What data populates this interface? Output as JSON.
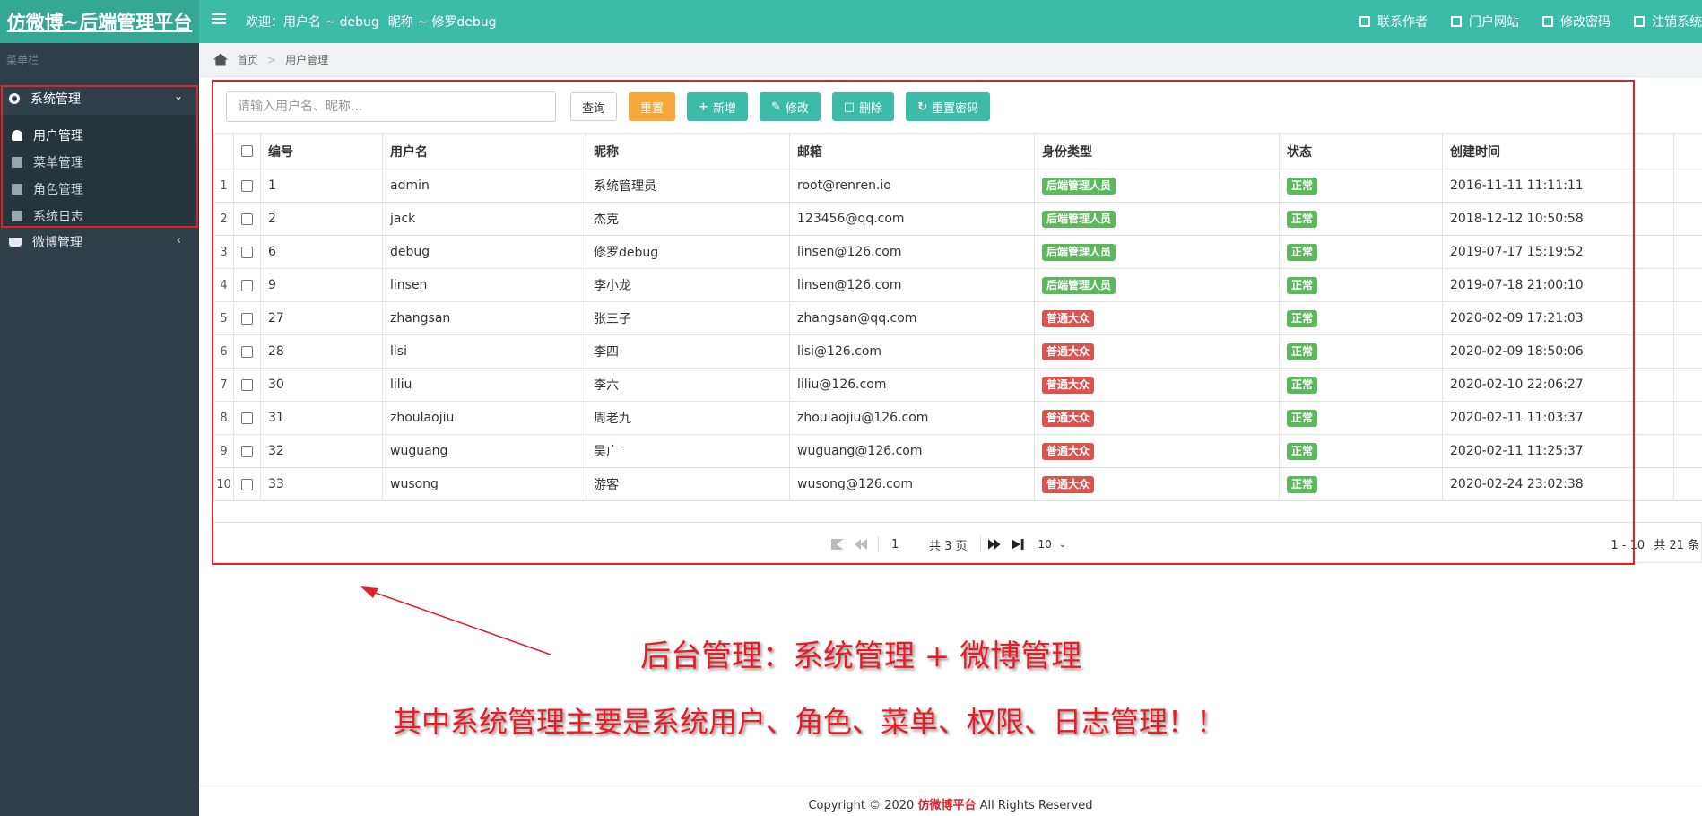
{
  "header": {
    "brand": "仿微博~后端管理平台",
    "welcome_prefix": "欢迎：",
    "welcome_user": "用户名 ~ debug",
    "welcome_nick": "昵称 ~ 修罗debug",
    "nav": [
      {
        "label": "联系作者",
        "icon": "external-link-icon"
      },
      {
        "label": "门户网站",
        "icon": "sign-out-icon"
      },
      {
        "label": "修改密码",
        "icon": "unlock-icon"
      },
      {
        "label": "注销系统",
        "icon": "sign-out-icon"
      }
    ]
  },
  "sidebar": {
    "caption": "菜单栏",
    "system_group": "系统管理",
    "items": [
      {
        "label": "用户管理",
        "icon": "user-icon"
      },
      {
        "label": "菜单管理",
        "icon": "list-icon"
      },
      {
        "label": "角色管理",
        "icon": "lock-icon"
      },
      {
        "label": "系统日志",
        "icon": "file-icon"
      }
    ],
    "weibo_group": "微博管理"
  },
  "breadcrumb": {
    "home": "首页",
    "sep": ">",
    "current": "用户管理"
  },
  "toolbar": {
    "search_placeholder": "请输入用户名、昵称...",
    "query": "查询",
    "reset": "重置",
    "add": "新增",
    "edit": "修改",
    "delete": "删除",
    "reset_password": "重置密码"
  },
  "table": {
    "headers": [
      "编号",
      "用户名",
      "昵称",
      "邮箱",
      "身份类型",
      "状态",
      "创建时间"
    ],
    "rows": [
      {
        "n": "1",
        "id": "1",
        "username": "admin",
        "nickname": "系统管理员",
        "email": "root@renren.io",
        "role": "后端管理人员",
        "role_type": "admin",
        "status": "正常",
        "created": "2016-11-11 11:11:11"
      },
      {
        "n": "2",
        "id": "2",
        "username": "jack",
        "nickname": "杰克",
        "email": "123456@qq.com",
        "role": "后端管理人员",
        "role_type": "admin",
        "status": "正常",
        "created": "2018-12-12 10:50:58"
      },
      {
        "n": "3",
        "id": "6",
        "username": "debug",
        "nickname": "修罗debug",
        "email": "linsen@126.com",
        "role": "后端管理人员",
        "role_type": "admin",
        "status": "正常",
        "created": "2019-07-17 15:19:52"
      },
      {
        "n": "4",
        "id": "9",
        "username": "linsen",
        "nickname": "李小龙",
        "email": "linsen@126.com",
        "role": "后端管理人员",
        "role_type": "admin",
        "status": "正常",
        "created": "2019-07-18 21:00:10"
      },
      {
        "n": "5",
        "id": "27",
        "username": "zhangsan",
        "nickname": "张三子",
        "email": "zhangsan@qq.com",
        "role": "普通大众",
        "role_type": "public",
        "status": "正常",
        "created": "2020-02-09 17:21:03"
      },
      {
        "n": "6",
        "id": "28",
        "username": "lisi",
        "nickname": "李四",
        "email": "lisi@126.com",
        "role": "普通大众",
        "role_type": "public",
        "status": "正常",
        "created": "2020-02-09 18:50:06"
      },
      {
        "n": "7",
        "id": "30",
        "username": "liliu",
        "nickname": "李六",
        "email": "liliu@126.com",
        "role": "普通大众",
        "role_type": "public",
        "status": "正常",
        "created": "2020-02-10 22:06:27"
      },
      {
        "n": "8",
        "id": "31",
        "username": "zhoulaojiu",
        "nickname": "周老九",
        "email": "zhoulaojiu@126.com",
        "role": "普通大众",
        "role_type": "public",
        "status": "正常",
        "created": "2020-02-11 11:03:37"
      },
      {
        "n": "9",
        "id": "32",
        "username": "wuguang",
        "nickname": "吴广",
        "email": "wuguang@126.com",
        "role": "普通大众",
        "role_type": "public",
        "status": "正常",
        "created": "2020-02-11 11:25:37"
      },
      {
        "n": "10",
        "id": "33",
        "username": "wusong",
        "nickname": "游客",
        "email": "wusong@126.com",
        "role": "普通大众",
        "role_type": "public",
        "status": "正常",
        "created": "2020-02-24 23:02:38"
      }
    ]
  },
  "pagination": {
    "page": "1",
    "total_pages": "共 3 页",
    "page_size": "10",
    "range": "1 - 10",
    "total": "共 21 条"
  },
  "annotations": {
    "line1": "后台管理：系统管理 + 微博管理",
    "line2": "其中系统管理主要是系统用户、角色、菜单、权限、日志管理！！"
  },
  "footer": {
    "prefix": "Copyright ©   2020",
    "brand": "仿微博平台",
    "suffix": "All Rights Reserved"
  },
  "colors": {
    "primary": "#3cbba8",
    "sidebar": "#2f3f48",
    "warning": "#f3a93c",
    "badge_admin": "#5cb85c",
    "badge_public": "#d9534f",
    "annotation": "#e81c25"
  }
}
